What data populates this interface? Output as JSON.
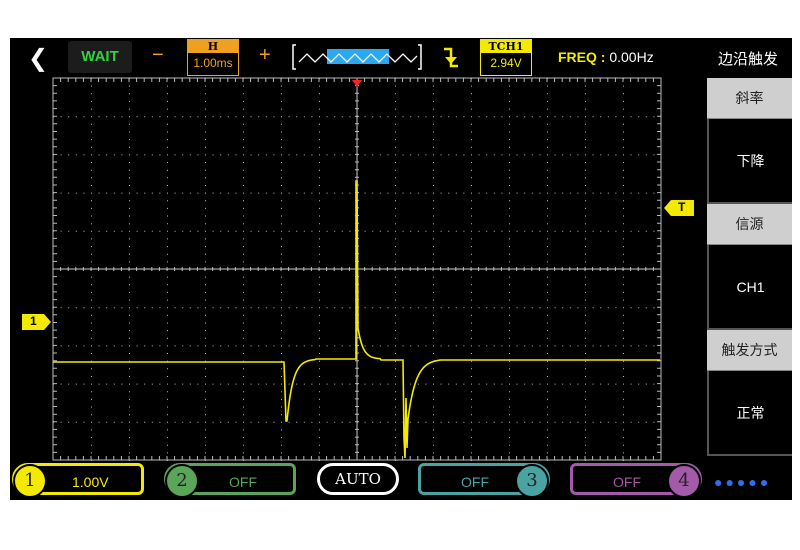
{
  "topbar": {
    "back_icon": "chevron-left-icon",
    "run_state": "WAIT",
    "zoom_out": "−",
    "zoom_in": "+",
    "timebase_label": "H",
    "timebase_value": "1.00ms",
    "trigger_edge_icon": "falling-edge-icon",
    "trigger_label": "TCH1",
    "trigger_level": "2.94V",
    "freq_label": "FREQ :",
    "freq_value": "0.00Hz",
    "menu_title": "边沿触发"
  },
  "menu": [
    {
      "header": "斜率",
      "value": "下降"
    },
    {
      "header": "信源",
      "value": "CH1"
    },
    {
      "header": "触发方式",
      "value": "正常"
    }
  ],
  "markers": {
    "channel1": "1",
    "trigger": "T"
  },
  "bottom": {
    "ch1": {
      "num": "1",
      "value": "1.00V",
      "color": "#f4ea00"
    },
    "ch2": {
      "num": "2",
      "value": "OFF",
      "color": "#5aa55a"
    },
    "auto": "AUTO",
    "ch3": {
      "num": "3",
      "value": "OFF",
      "color": "#4aa3a3"
    },
    "ch4": {
      "num": "4",
      "value": "OFF",
      "color": "#a35aa8"
    },
    "more": "●●●●●"
  },
  "colors": {
    "trace": "#f4ea00",
    "trigger_pos": "#ff2020",
    "timebase": "#f0a020",
    "wait": "#2fd33a"
  }
}
